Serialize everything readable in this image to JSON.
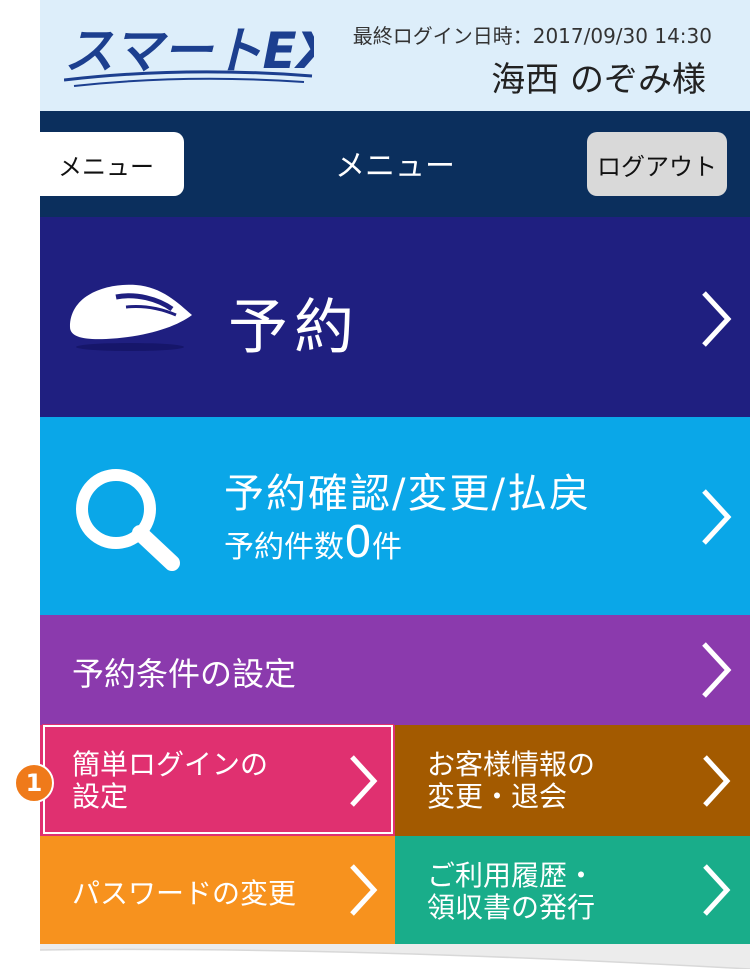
{
  "header": {
    "logo_text": "スマートEX",
    "last_login": "最終ログイン日時：2017/09/30 14:30",
    "user_name": "海西 のぞみ様"
  },
  "navbar": {
    "menu_button": "メニュー",
    "title": "メニュー",
    "logout_button": "ログアウト"
  },
  "tiles": {
    "reserve": {
      "label": "予約",
      "icon": "shinkansen-icon",
      "color": "#1f1f80"
    },
    "check": {
      "title": "予約確認/変更/払戻",
      "count_prefix": "予約件数",
      "count": "0",
      "count_suffix": "件",
      "icon": "search-icon",
      "color": "#0aa7e8"
    },
    "conditions": {
      "label": "予約条件の設定",
      "color": "#8b3aad"
    },
    "simple_login": {
      "line1": "簡単ログインの",
      "line2": "設定",
      "color": "#e03070"
    },
    "customer": {
      "line1": "お客様情報の",
      "line2": "変更・退会",
      "color": "#a35a00"
    },
    "password": {
      "label": "パスワードの変更",
      "color": "#f7921e"
    },
    "history": {
      "line1": "ご利用履歴・",
      "line2": "領収書の発行",
      "color": "#19ad8a"
    }
  },
  "annotation": {
    "marker": "1"
  }
}
